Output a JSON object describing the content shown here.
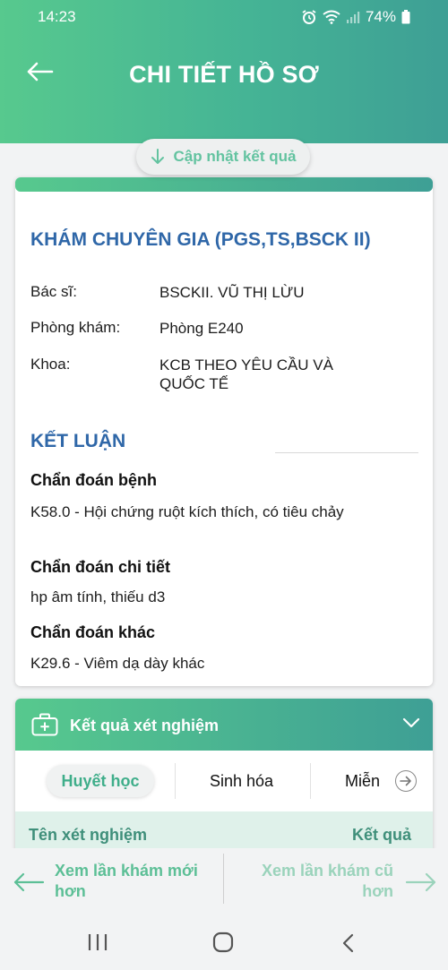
{
  "status": {
    "time": "14:23",
    "battery": "74%"
  },
  "header": {
    "title": "CHI TIẾT HỒ SƠ"
  },
  "update": {
    "label": "Cập nhật kết quả"
  },
  "exam": {
    "title": "KHÁM CHUYÊN GIA (PGS,TS,BSCK II)",
    "doctor_label": "Bác sĩ:",
    "doctor_value": "BSCKII. VŨ THỊ LỪU",
    "room_label": "Phòng khám:",
    "room_value": "Phòng E240",
    "dept_label": "Khoa:",
    "dept_value": "KCB THEO YÊU CẦU VÀ QUỐC TẾ"
  },
  "conclusion": {
    "title": "KẾT LUẬN",
    "diagnosis_head": "Chẩn đoán bệnh",
    "diagnosis_text": "K58.0 - Hội chứng ruột kích thích, có tiêu chảy",
    "detail_head": "Chẩn đoán chi tiết",
    "detail_text": "hp âm tính, thiếu d3",
    "other_head": "Chẩn đoán khác",
    "other_text": "K29.6 - Viêm dạ dày khác"
  },
  "tests": {
    "title": "Kết quả xét nghiệm",
    "tabs": [
      "Huyết học",
      "Sinh hóa",
      "Miễn"
    ],
    "col_name": "Tên xét nghiệm",
    "col_result": "Kết quả"
  },
  "visit_nav": {
    "prev_label": "Xem lần khám mới hơn",
    "next_label": "Xem lần khám cũ hơn"
  },
  "colors": {
    "accent": "#45b495",
    "title_blue": "#2f67a8"
  }
}
